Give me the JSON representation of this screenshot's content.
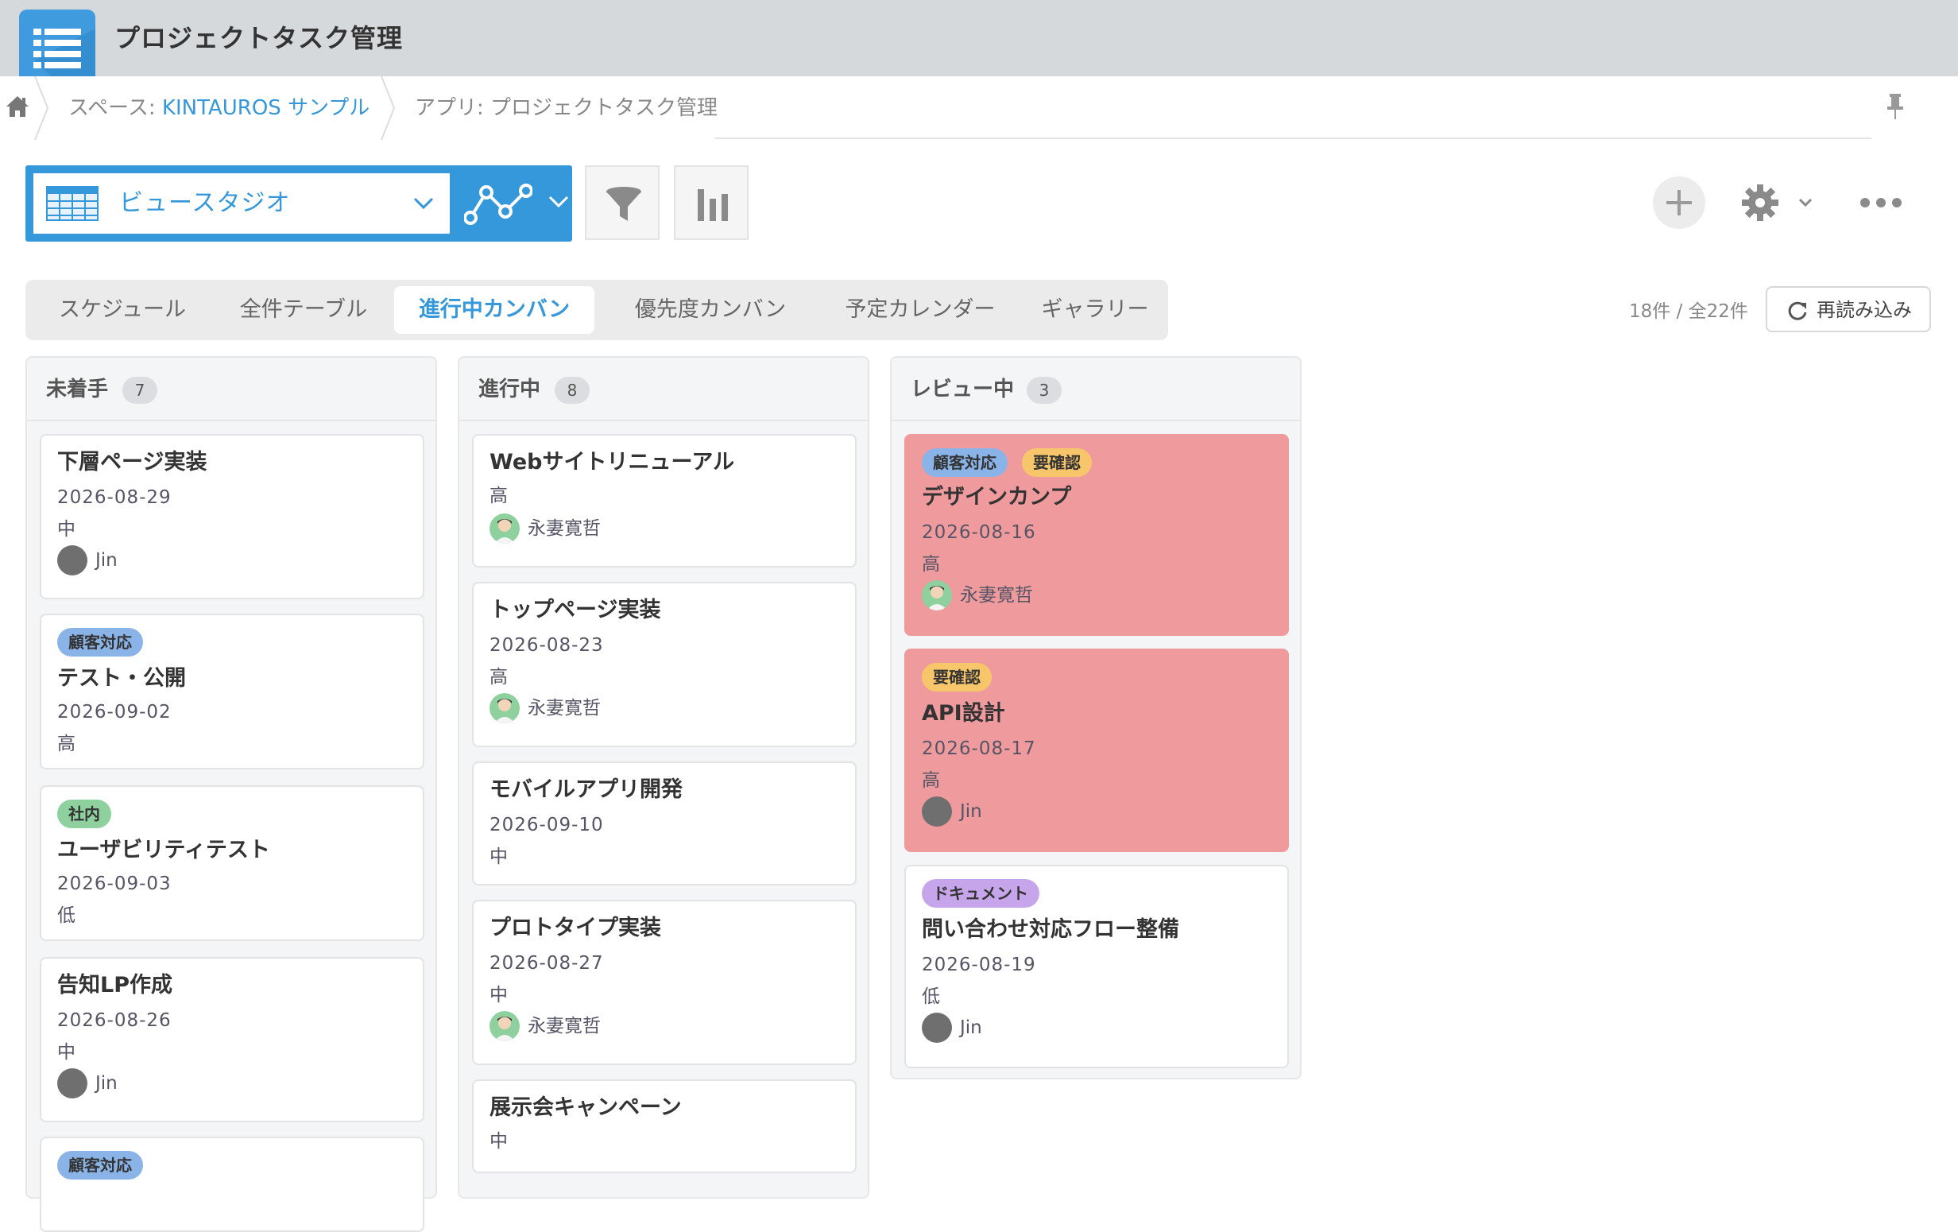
{
  "app": {
    "title": "プロジェクトタスク管理",
    "accent_color": "#3498db",
    "icon": "app-list-icon"
  },
  "breadcrumb": {
    "home_icon": "home-icon",
    "space_prefix": "スペース: ",
    "space_name": "KINTAUROS サンプル",
    "app_label": "アプリ: プロジェクトタスク管理",
    "pin_icon": "pin-icon"
  },
  "toolbar": {
    "view_selector": {
      "label": "ビュースタジオ",
      "icon": "table-icon"
    },
    "graph_icon": "graph-icon",
    "filter_icon": "filter-icon",
    "chart_icon": "bar-chart-icon",
    "add_icon": "plus-icon",
    "settings_icon": "gear-icon",
    "more_icon": "more-icon"
  },
  "tabs": [
    {
      "label": "スケジュール",
      "active": false
    },
    {
      "label": "全件テーブル",
      "active": false
    },
    {
      "label": "進行中カンバン",
      "active": true
    },
    {
      "label": "優先度カンバン",
      "active": false
    },
    {
      "label": "予定カレンダー",
      "active": false
    },
    {
      "label": "ギャラリー",
      "active": false
    }
  ],
  "record_count": "18件 / 全22件",
  "reload_label": "再読み込み",
  "tag_colors": {
    "顧客対応": "#8ab4e8",
    "要確認": "#f8c66a",
    "社内": "#8fd19e",
    "ドキュメント": "#c7a5ea"
  },
  "highlight_color": "#ef9a9d",
  "columns": [
    {
      "title": "未着手",
      "count": "7",
      "cards": [
        {
          "title": "下層ページ実装",
          "date": "2026-08-29",
          "priority": "中",
          "user": "Jin",
          "tags": []
        },
        {
          "title": "テスト・公開",
          "date": "2026-09-02",
          "priority": "高",
          "tags": [
            "顧客対応"
          ]
        },
        {
          "title": "ユーザビリティテスト",
          "date": "2026-09-03",
          "priority": "低",
          "tags": [
            "社内"
          ]
        },
        {
          "title": "告知LP作成",
          "date": "2026-08-26",
          "priority": "中",
          "user": "Jin",
          "tags": []
        },
        {
          "tags": [
            "顧客対応"
          ]
        }
      ]
    },
    {
      "title": "進行中",
      "count": "8",
      "cards": [
        {
          "title": "Webサイトリニューアル",
          "priority": "高",
          "user": "永妻寛哲",
          "tags": []
        },
        {
          "title": "トップページ実装",
          "date": "2026-08-23",
          "priority": "高",
          "user": "永妻寛哲",
          "tags": []
        },
        {
          "title": "モバイルアプリ開発",
          "date": "2026-09-10",
          "priority": "中",
          "tags": []
        },
        {
          "title": "プロトタイプ実装",
          "date": "2026-08-27",
          "priority": "中",
          "user": "永妻寛哲",
          "tags": []
        },
        {
          "title": "展示会キャンペーン",
          "priority": "中",
          "tags": []
        }
      ]
    },
    {
      "title": "レビュー中",
      "count": "3",
      "cards": [
        {
          "title": "デザインカンプ",
          "date": "2026-08-16",
          "priority": "高",
          "user": "永妻寛哲",
          "tags": [
            "顧客対応",
            "要確認"
          ],
          "highlight": true
        },
        {
          "title": "API設計",
          "date": "2026-08-17",
          "priority": "高",
          "user": "Jin",
          "tags": [
            "要確認"
          ],
          "highlight": true
        },
        {
          "title": "問い合わせ対応フロー整備",
          "date": "2026-08-19",
          "priority": "低",
          "user": "Jin",
          "tags": [
            "ドキュメント"
          ]
        }
      ]
    }
  ]
}
